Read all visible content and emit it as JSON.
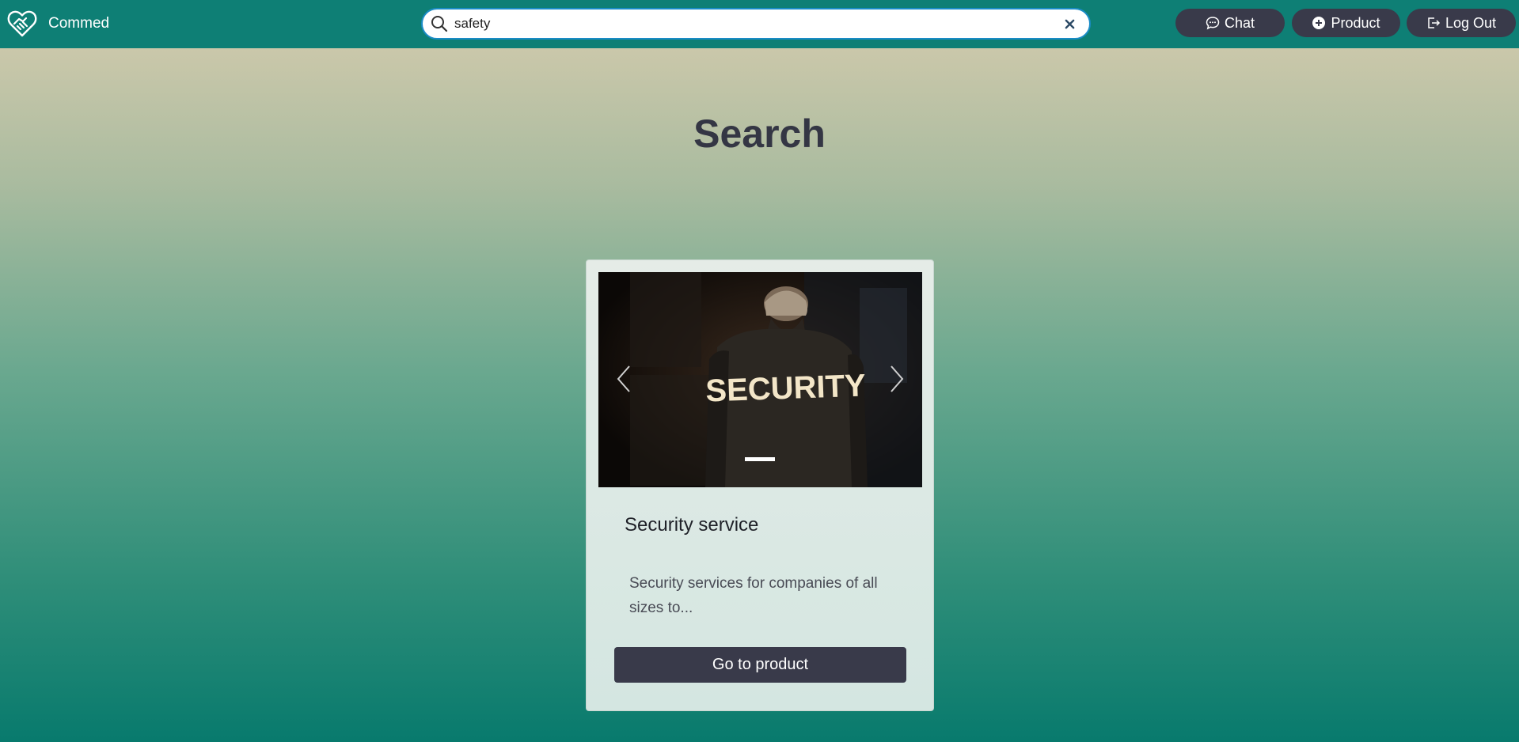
{
  "header": {
    "brand_name": "Commed",
    "logo_icon": "heart-handshake-icon",
    "search": {
      "value": "safety",
      "icon": "search-icon",
      "clear_icon": "close-icon"
    },
    "buttons": {
      "chat": {
        "label": "Chat",
        "icon": "chat-bubble-icon"
      },
      "product": {
        "label": "Product",
        "icon": "plus-circle-icon"
      },
      "logout": {
        "label": "Log Out",
        "icon": "logout-icon"
      }
    },
    "colors": {
      "navbar": "#0e7f75",
      "button": "#393a4a",
      "search_border": "#1a8cc6"
    }
  },
  "main": {
    "title": "Search",
    "results": [
      {
        "image_alt": "Security guard wearing SECURITY shirt",
        "image_text": "SECURITY",
        "title": "Security service",
        "description": "Security services for companies of all sizes to...",
        "button_label": "Go to product"
      }
    ]
  }
}
